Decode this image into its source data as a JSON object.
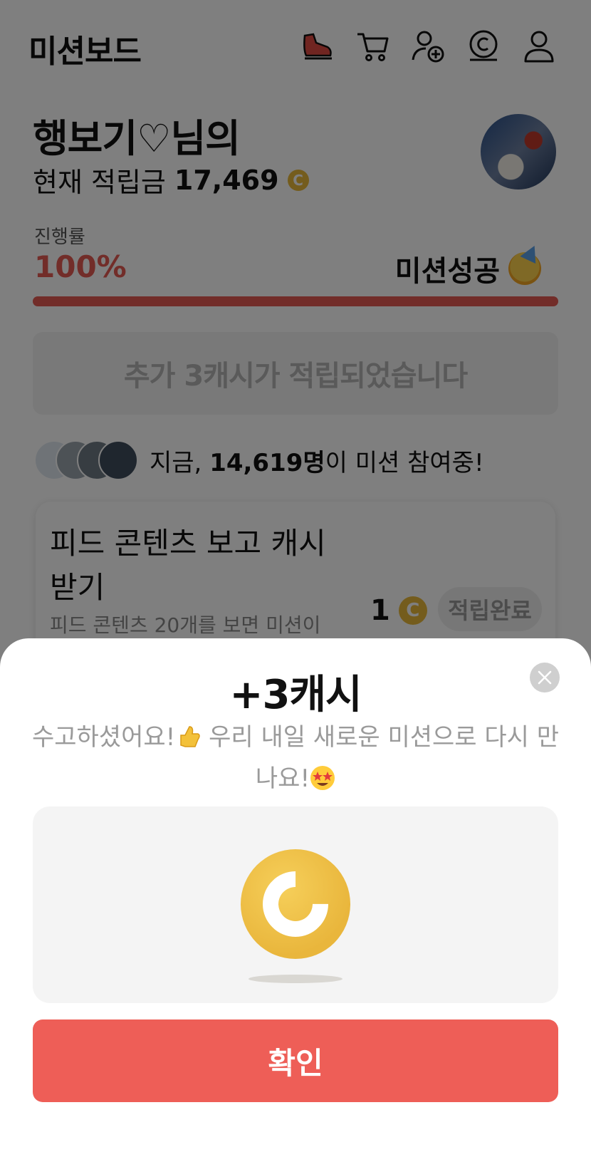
{
  "header": {
    "title": "미션보드",
    "icons": [
      "shoe-icon",
      "cart-icon",
      "add-friend-icon",
      "cash-coin-icon",
      "profile-icon"
    ]
  },
  "user": {
    "greeting": "행보기♡님의",
    "balance_label": "현재 적립금",
    "balance_value": "17,469",
    "coin_symbol": "C"
  },
  "progress": {
    "label": "진행률",
    "value_text": "100%",
    "value": 1.0,
    "status": "미션성공",
    "color": "#e45a52"
  },
  "notice": {
    "text": "추가 3캐시가 적립되었습니다"
  },
  "participants": {
    "prefix": "지금, ",
    "count": "14,619명",
    "suffix": "이 미션 참여중!"
  },
  "mission_card": {
    "title": "피드 콘텐츠 보고 캐시 받기",
    "description": "피드 콘텐츠 20개를 보면 미션이",
    "reward": "1",
    "status": "적립완료"
  },
  "sheet": {
    "title": "+3캐시",
    "message_part1": "수고하셨어요!",
    "message_part2": " 우리 내일 새로운 미션으로 다시 만나요!",
    "confirm_label": "확인",
    "button_color": "#ee5e57",
    "coin_color": "#e9b63c"
  }
}
